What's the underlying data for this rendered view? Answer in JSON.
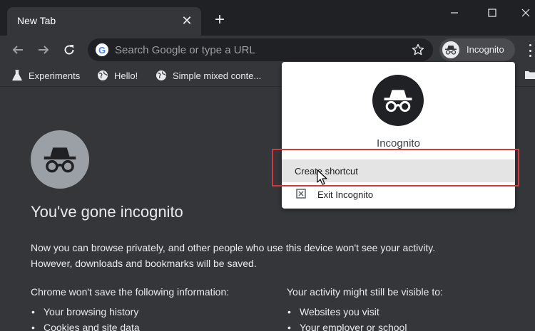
{
  "window": {
    "tab_title": "New Tab",
    "tab_close_symbol": "✕",
    "new_tab_symbol": "+"
  },
  "toolbar": {
    "omnibox_placeholder": "Search Google or type a URL",
    "google_letter": "G",
    "profile_label": "Incognito"
  },
  "bookmarks": [
    {
      "label": "Experiments",
      "icon": "flask-icon"
    },
    {
      "label": "Hello!",
      "icon": "globe-icon"
    },
    {
      "label": "Simple mixed conte...",
      "icon": "globe-icon"
    }
  ],
  "main": {
    "headline": "You've gone incognito",
    "paragraph_line1": "Now you can browse privately, and other people who use this device won't see your activity.",
    "paragraph_line2": "However, downloads and bookmarks will be saved.",
    "left_column": {
      "title": "Chrome won't save the following information:",
      "items": [
        "Your browsing history",
        "Cookies and site data"
      ]
    },
    "right_column": {
      "title": "Your activity might still be visible to:",
      "items": [
        "Websites you visit",
        "Your employer or school"
      ]
    }
  },
  "dropdown": {
    "name": "Incognito",
    "create_shortcut": "Create shortcut",
    "exit_incognito": "Exit Incognito"
  },
  "colors": {
    "page_bg": "#35363a",
    "titlebar_bg": "#202124",
    "highlight_border": "#d03a3a"
  }
}
